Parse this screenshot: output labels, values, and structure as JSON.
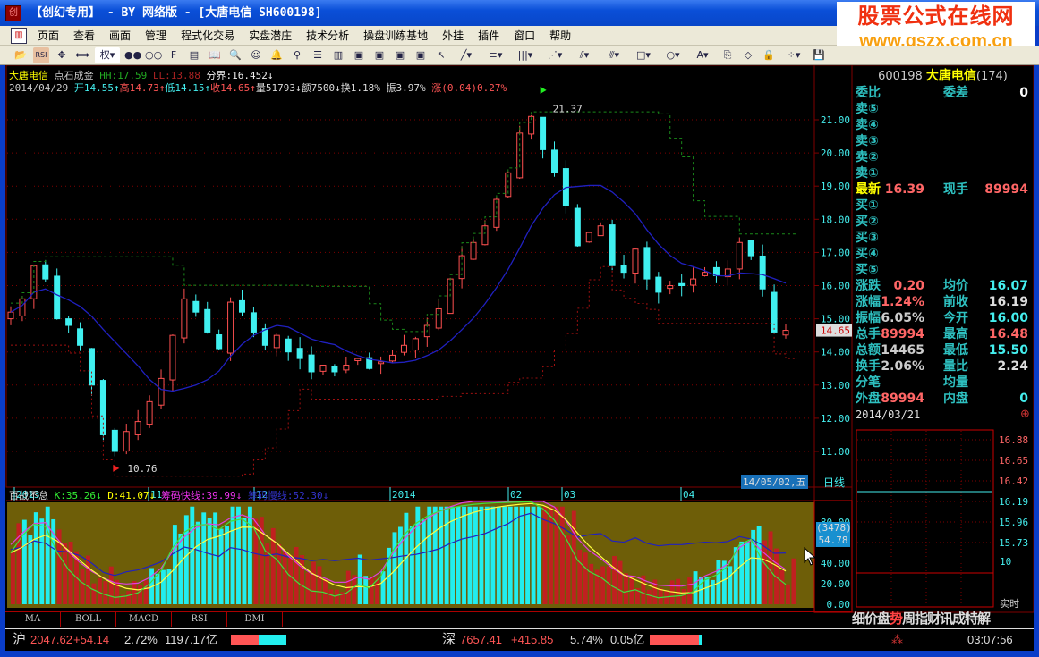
{
  "window": {
    "title": "【创幻专用】 - BY 网络版 - [大唐电信 SH600198]",
    "logo_text": "创"
  },
  "watermark": {
    "line1": "股票公式在线网",
    "line2": "www.gszx.com.cn"
  },
  "menu": [
    "页面",
    "查看",
    "画面",
    "管理",
    "程式化交易",
    "实盘潜庄",
    "技术分析",
    "操盘训练基地",
    "外挂",
    "插件",
    "窗口",
    "帮助"
  ],
  "toolbar": {
    "icons": [
      "open-icon",
      "rsi-icon",
      "move-icon",
      "resize-icon",
      "rights-select",
      "compare-icon",
      "overlay-icon",
      "f10-icon",
      "files-icon",
      "book-icon",
      "search-icon",
      "expert-icon",
      "alarm-icon",
      "plug-icon",
      "layout-rows-icon",
      "layout-cols-icon",
      "window1-icon",
      "window2-icon",
      "window3-icon",
      "window4-icon",
      "pointer-icon",
      "line-tool-icon",
      "text-lines-icon",
      "vertical-lines-icon",
      "fan-icon",
      "channel-icon",
      "parallel-icon",
      "rect-icon",
      "circle-icon",
      "text-tool-icon",
      "copy-icon",
      "eraser-icon",
      "lock-icon",
      "colors-icon",
      "save-icon"
    ],
    "rights_label": "权",
    "rsi_label": "RSI"
  },
  "header": {
    "stock_name": "大唐电信",
    "indicator": "点石成金",
    "hh": "HH:17.59",
    "ll": "LL:13.88",
    "boundary": "分界:16.452↓",
    "date": "2014/04/29",
    "open": "开14.55↑",
    "high": "高14.73↑",
    "low": "低14.15↑",
    "close": "收14.65↑",
    "volume": "量51793↓",
    "amount": "额7500↓",
    "turnover": "换1.18%",
    "amplitude": "振3.97%",
    "change": "涨(0.04)0.27%"
  },
  "chart": {
    "price_ticks": [
      "21.00",
      "20.00",
      "19.00",
      "18.00",
      "17.00",
      "16.00",
      "15.00",
      "14.00",
      "13.00",
      "12.00",
      "11.00"
    ],
    "high_label": "21.37",
    "low_label": "10.76",
    "current_price": "14.65",
    "date_labels": [
      "2013",
      "11",
      "12",
      "2014",
      "02",
      "03",
      "04"
    ],
    "cursor_date": "14/05/02,五",
    "period": "日线",
    "price_path": [
      15.2,
      15.6,
      16.6,
      16.2,
      15.0,
      14.8,
      14.2,
      13.0,
      11.5,
      11.0,
      11.6,
      11.9,
      12.5,
      13.2,
      14.5,
      15.6,
      15.2,
      14.6,
      14.1,
      15.5,
      15.2,
      14.6,
      14.2,
      14.5,
      14.0,
      13.8,
      13.4,
      13.6,
      13.4,
      13.6,
      13.8,
      13.5,
      13.7,
      13.9,
      14.2,
      14.4,
      14.8,
      15.3,
      16.2,
      16.9,
      17.3,
      17.8,
      18.6,
      19.4,
      20.6,
      21.1,
      20.1,
      19.4,
      18.4,
      17.2,
      17.6,
      17.8,
      16.6,
      16.4,
      17.1,
      16.2,
      15.8,
      16.0,
      16.0,
      16.2,
      16.4,
      16.3,
      16.5,
      17.3,
      16.9,
      15.9,
      14.6,
      14.65
    ],
    "colors": {
      "up": "#ff5050",
      "down": "#40f0f0",
      "ma": "#2020c0",
      "upper": "#1a8a1a",
      "lower": "#a01010",
      "grid": "#800000"
    }
  },
  "indicator": {
    "name": "百战不怠",
    "k": "K:35.26↓",
    "d": "D:41.07↓",
    "fast": "筹码快线:39.99↓",
    "slow": "筹码慢线:52.30↓",
    "ticks": [
      "80.00",
      "40.00",
      "20.00",
      "0.00"
    ],
    "cursor_value1": "(3478)",
    "cursor_value2": "54.78"
  },
  "tabs": [
    "MA",
    "BOLL",
    "MACD",
    "RSI",
    "DMI"
  ],
  "quote": {
    "code": "600198",
    "name": "大唐电信",
    "count": "(174)",
    "rows": [
      {
        "l": "委比",
        "v": "",
        "l2": "委差",
        "v2": "0"
      },
      {
        "l": "卖⑤"
      },
      {
        "l": "卖④"
      },
      {
        "l": "卖③"
      },
      {
        "l": "卖②"
      },
      {
        "l": "卖①"
      },
      {
        "l": "最新",
        "v": "16.39",
        "l2": "现手",
        "v2": "89994"
      },
      {
        "l": "买①"
      },
      {
        "l": "买②"
      },
      {
        "l": "买③"
      },
      {
        "l": "买④"
      },
      {
        "l": "买⑤"
      },
      {
        "l": "涨跌",
        "v": "0.20",
        "l2": "均价",
        "v2": "16.07"
      },
      {
        "l": "涨幅",
        "v": "1.24%",
        "l2": "前收",
        "v2": "16.19"
      },
      {
        "l": "振幅",
        "v": "6.05%",
        "l2": "今开",
        "v2": "16.00"
      },
      {
        "l": "总手",
        "v": "89994",
        "l2": "最高",
        "v2": "16.48"
      },
      {
        "l": "总额",
        "v": "14465",
        "l2": "最低",
        "v2": "15.50"
      },
      {
        "l": "换手",
        "v": "2.06%",
        "l2": "量比",
        "v2": "2.24"
      },
      {
        "l": "分笔",
        "v": "",
        "l2": "均量",
        "v2": ""
      },
      {
        "l": "外盘",
        "v": "89994",
        "l2": "内盘",
        "v2": "0"
      }
    ],
    "minute_date": "2014/03/21",
    "minute_ticks": [
      "16.88",
      "16.65",
      "16.42",
      "16.19",
      "15.96",
      "15.73"
    ],
    "volume_tick": "10",
    "realtime": "实时"
  },
  "bottom_links": [
    "细",
    "价",
    "盘",
    "势",
    "周",
    "指",
    "财",
    "讯",
    "成",
    "特",
    "解"
  ],
  "status": {
    "sh_label": "沪",
    "sh_index": "2047.62",
    "sh_change": "+54.14",
    "sh_pct": "2.72%",
    "sh_amount": "1197.17亿",
    "sz_label": "深",
    "sz_index": "7657.41",
    "sz_change": "+415.85",
    "sz_pct": "5.74%",
    "sz_amount": "0.05亿",
    "time": "03:07:56"
  }
}
